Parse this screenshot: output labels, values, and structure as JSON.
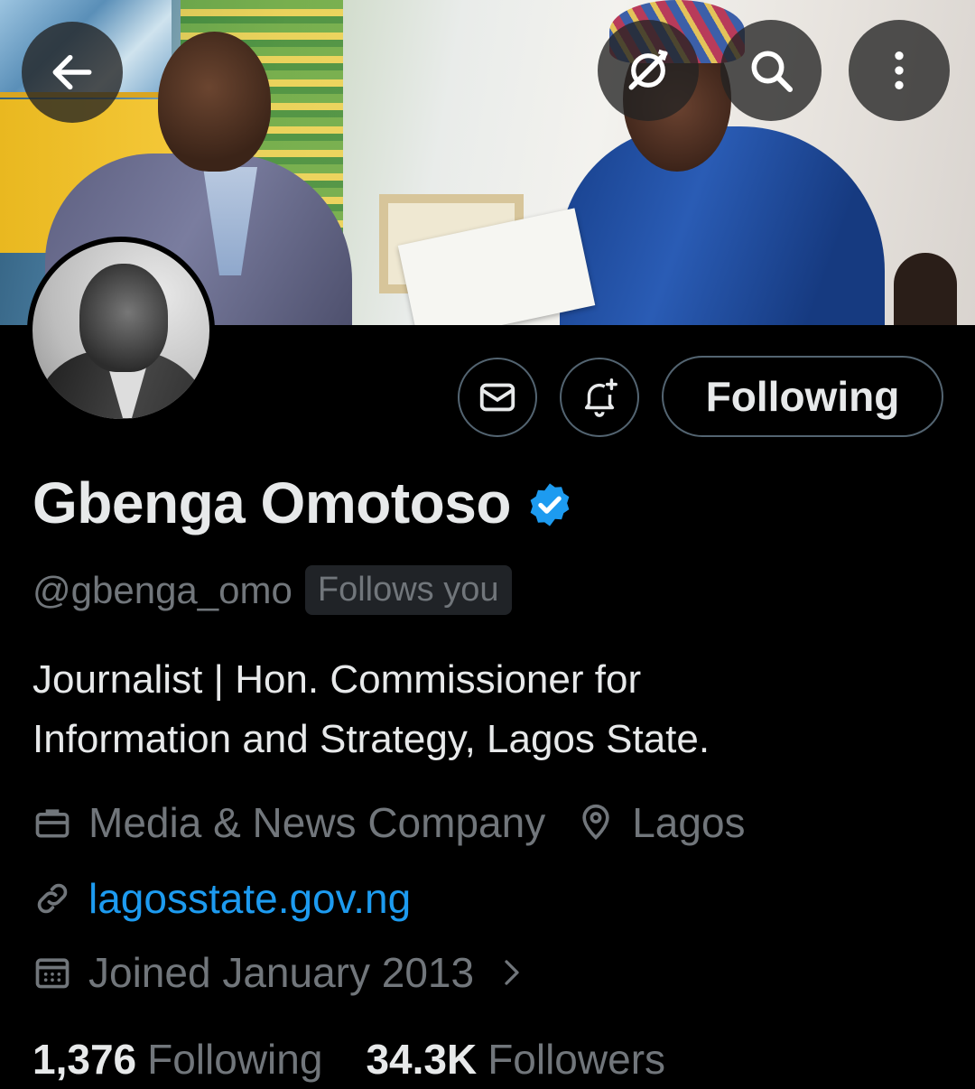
{
  "profile": {
    "name": "Gbenga Omotoso",
    "handle": "@gbenga_omo",
    "follows_you": "Follows you",
    "bio": "Journalist |  Hon. Commissioner for\nInformation and Strategy, Lagos State.",
    "category": "Media & News Company",
    "location": "Lagos",
    "website": "lagosstate.gov.ng",
    "joined": "Joined January 2013",
    "following_count": "1,376",
    "following_label": "Following",
    "followers_count": "34.3K",
    "followers_label": "Followers"
  },
  "actions": {
    "follow_state_label": "Following"
  },
  "colors": {
    "background": "#000000",
    "primary_text": "#e7e9ea",
    "secondary_text": "#71767b",
    "link": "#1d9bf0",
    "verified": "#1d9bf0",
    "border": "#536471"
  },
  "icons": {
    "back": "arrow-left-icon",
    "grok": "grok-icon",
    "search": "search-icon",
    "more": "more-vertical-icon",
    "message": "mail-icon",
    "notify": "bell-plus-icon",
    "verified": "verified-badge-icon",
    "category": "briefcase-icon",
    "location": "location-pin-icon",
    "website": "link-icon",
    "joined": "calendar-icon"
  }
}
